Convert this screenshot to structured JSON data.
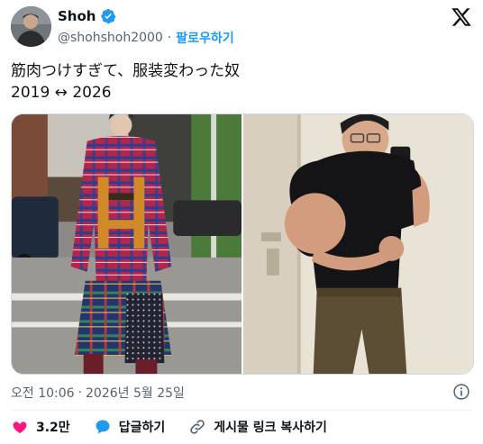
{
  "author": {
    "display_name": "Shoh",
    "handle": "@shohshoh2000",
    "separator": "·",
    "follow_label": "팔로우하기",
    "verified": true
  },
  "tweet": {
    "line1": "筋肉つけすぎて、服装変わった奴",
    "line2": "2019 ↔︎ 2026"
  },
  "timestamp": {
    "time": "오전 10:06",
    "separator": "·",
    "date": "2026년 5월 25일"
  },
  "actions": {
    "like_count": "3.2만",
    "reply_label": "답글하기",
    "copy_link_label": "게시물 링크 복사하기"
  },
  "colors": {
    "accent": "#1d9bf0",
    "like": "#f91880",
    "secondary_text": "#536471",
    "primary_text": "#0f1419"
  },
  "icons": {
    "verified": "verified-badge-icon",
    "logo": "x-logo-icon",
    "info": "info-icon",
    "like": "heart-icon",
    "reply": "reply-bubble-icon",
    "link": "link-icon"
  }
}
